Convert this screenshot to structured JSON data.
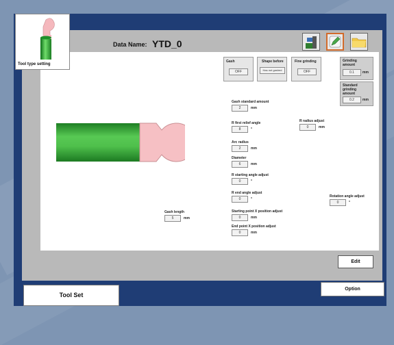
{
  "header": {
    "tool_type_label": "Tool type setting",
    "data_name_label": "Data Name:",
    "data_name_value": "YTD_0"
  },
  "toolbar": {
    "icons": [
      "machine-tool-icon",
      "edit-pencil-icon",
      "folder-icon"
    ]
  },
  "gash": {
    "label": "Gash",
    "value": "OFF"
  },
  "shape_before": {
    "label": "Shape before",
    "value": "Has not gashed"
  },
  "fine_grinding": {
    "label": "Fine grinding",
    "value": "OFF"
  },
  "grinding_amount": {
    "label": "Grinding amount",
    "value": "0.1",
    "unit": "mm"
  },
  "standard_grinding": {
    "label": "Standard grinding amount",
    "value": "0.2",
    "unit": "mm"
  },
  "fields": {
    "gash_standard": {
      "label": "Gash standard amount",
      "value": "2",
      "unit": "mm"
    },
    "r_first_relief": {
      "label": "R first relief angle",
      "value": "8",
      "unit": "°"
    },
    "r_radius_adjust": {
      "label": "R radius adjust",
      "value": "0",
      "unit": "mm"
    },
    "arc_radius": {
      "label": "Arc radius",
      "value": "2",
      "unit": "mm"
    },
    "diameter": {
      "label": "Diameter",
      "value": "6",
      "unit": "mm"
    },
    "r_start_angle": {
      "label": "R starting angle adjust",
      "value": "0",
      "unit": "°"
    },
    "r_end_angle": {
      "label": "R end angle adjust",
      "value": "0",
      "unit": "°"
    },
    "rotation_angle": {
      "label": "Rotation angle adjust",
      "value": "0",
      "unit": "°"
    },
    "gash_length": {
      "label": "Gash length",
      "value": "5",
      "unit": "mm"
    },
    "start_x": {
      "label": "Starting point X position adjust",
      "value": "0",
      "unit": "mm"
    },
    "end_x": {
      "label": "End point X position adjust",
      "value": "0",
      "unit": "mm"
    }
  },
  "buttons": {
    "edit": "Edit",
    "tool_set": "Tool Set",
    "option": "Option"
  },
  "colors": {
    "frame": "#1f3d75",
    "tool_green": "#2e9e2e",
    "tool_pink": "#f6c0c4"
  }
}
